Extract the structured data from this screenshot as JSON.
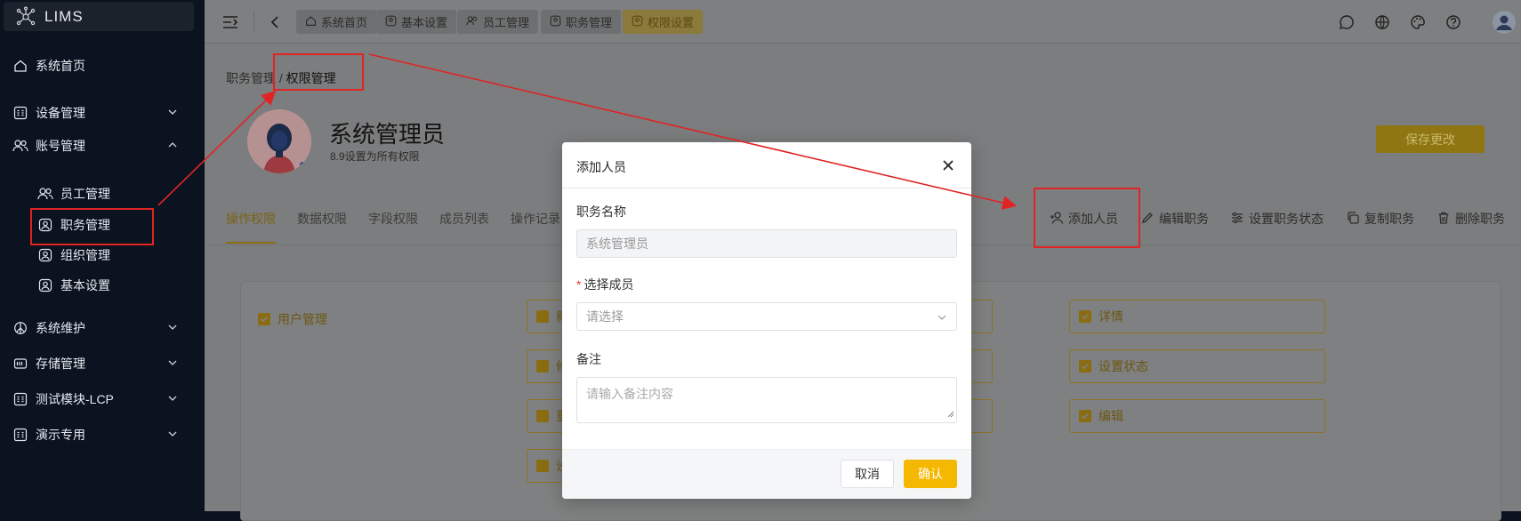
{
  "app": {
    "name": "LIMS"
  },
  "sidebar": {
    "items": [
      {
        "label": "系统首页",
        "icon": "home-icon"
      },
      {
        "label": "设备管理",
        "icon": "grid-icon",
        "expanded": false
      },
      {
        "label": "账号管理",
        "icon": "users-icon",
        "expanded": true
      },
      {
        "label": "系统维护",
        "icon": "peace-icon",
        "expanded": false
      },
      {
        "label": "存储管理",
        "icon": "storage-icon",
        "expanded": false
      },
      {
        "label": "测试模块-LCP",
        "icon": "grid-icon",
        "expanded": false
      },
      {
        "label": "演示专用",
        "icon": "grid-icon",
        "expanded": false
      }
    ],
    "subitems": [
      {
        "label": "员工管理",
        "icon": "users-icon"
      },
      {
        "label": "职务管理",
        "icon": "person-box-icon",
        "active": true
      },
      {
        "label": "组织管理",
        "icon": "person-box-icon"
      },
      {
        "label": "基本设置",
        "icon": "person-box-icon"
      }
    ]
  },
  "topbar": {
    "tabs": [
      {
        "label": "系统首页",
        "icon": "home-icon"
      },
      {
        "label": "基本设置",
        "icon": "person-box-icon"
      },
      {
        "label": "员工管理",
        "icon": "users-icon"
      },
      {
        "label": "职务管理",
        "icon": "person-box-icon"
      },
      {
        "label": "权限设置",
        "icon": "person-box-icon",
        "active": true
      }
    ]
  },
  "page": {
    "breadcrumb": {
      "parent": "职务管理",
      "separator": "/",
      "current": "权限管理"
    },
    "title": "系统管理员",
    "subtitle": "8.9设置为所有权限",
    "save_label": "保存更改",
    "tabs": [
      "操作权限",
      "数据权限",
      "字段权限",
      "成员列表",
      "操作记录"
    ],
    "actions": [
      "添加人员",
      "编辑职务",
      "设置职务状态",
      "复制职务",
      "删除职务"
    ],
    "permissions": {
      "group": "用户管理",
      "right_col": [
        "详情",
        "设置状态",
        "编辑"
      ],
      "left_col_partial": [
        "新",
        "修",
        "重",
        "设"
      ]
    }
  },
  "modal": {
    "title": "添加人员",
    "role_label": "职务名称",
    "role_value": "系统管理员",
    "member_label": "选择成员",
    "member_placeholder": "请选择",
    "note_label": "备注",
    "note_placeholder": "请输入备注内容",
    "cancel_label": "取消",
    "confirm_label": "确认"
  },
  "colors": {
    "accent": "#f5b800",
    "annotation": "#e02424",
    "sidebar_bg": "#0b1220"
  }
}
